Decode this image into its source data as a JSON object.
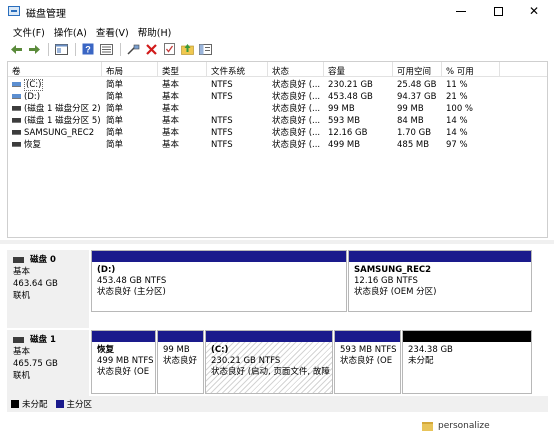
{
  "window": {
    "title": "磁盘管理",
    "minimize": "–",
    "maximize": "□",
    "close": "✕"
  },
  "menu": [
    "文件(F)",
    "操作(A)",
    "查看(V)",
    "帮助(H)"
  ],
  "toolbar": {
    "icons": [
      "back-arrow-icon",
      "forward-arrow-icon",
      "console-icon",
      "help-icon",
      "list-view-icon",
      "connect-icon",
      "delete-icon",
      "properties-icon",
      "folder-up-icon",
      "info-icon",
      "refresh-icon"
    ]
  },
  "volume_list": {
    "headers": [
      "卷",
      "布局",
      "类型",
      "文件系统",
      "状态",
      "容量",
      "可用空间",
      "% 可用"
    ],
    "rows": [
      {
        "name": "(C:)",
        "layout": "简单",
        "type": "基本",
        "fs": "NTFS",
        "status": "状态良好 (...",
        "capacity": "230.21 GB",
        "free": "25.48 GB",
        "pct": "11 %",
        "icon": "blue",
        "selected": true
      },
      {
        "name": "(D:)",
        "layout": "简单",
        "type": "基本",
        "fs": "NTFS",
        "status": "状态良好 (...",
        "capacity": "453.48 GB",
        "free": "94.37 GB",
        "pct": "21 %",
        "icon": "blue",
        "selected": false
      },
      {
        "name": "(磁盘 1 磁盘分区 2)",
        "layout": "简单",
        "type": "基本",
        "fs": "",
        "status": "状态良好 (...",
        "capacity": "99 MB",
        "free": "99 MB",
        "pct": "100 %",
        "icon": "dark",
        "selected": false
      },
      {
        "name": "(磁盘 1 磁盘分区 5)",
        "layout": "简单",
        "type": "基本",
        "fs": "NTFS",
        "status": "状态良好 (...",
        "capacity": "593 MB",
        "free": "84 MB",
        "pct": "14 %",
        "icon": "dark",
        "selected": false
      },
      {
        "name": "SAMSUNG_REC2",
        "layout": "简单",
        "type": "基本",
        "fs": "NTFS",
        "status": "状态良好 (...",
        "capacity": "12.16 GB",
        "free": "1.70 GB",
        "pct": "14 %",
        "icon": "dark",
        "selected": false
      },
      {
        "name": "恢复",
        "layout": "简单",
        "type": "基本",
        "fs": "NTFS",
        "status": "状态良好 (...",
        "capacity": "499 MB",
        "free": "485 MB",
        "pct": "97 %",
        "icon": "dark",
        "selected": false
      }
    ]
  },
  "disks": [
    {
      "name": "磁盘 0",
      "type": "基本",
      "size": "463.64 GB",
      "status": "联机",
      "partitions": [
        {
          "name": "(D:)",
          "size": "453.48 GB NTFS",
          "status": "状态良好 (主分区)"
        },
        {
          "name": "SAMSUNG_REC2",
          "size": "12.16 GB NTFS",
          "status": "状态良好 (OEM 分区)"
        }
      ]
    },
    {
      "name": "磁盘 1",
      "type": "基本",
      "size": "465.75 GB",
      "status": "联机",
      "partitions": [
        {
          "name": "恢复",
          "size": "499 MB NTFS",
          "status": "状态良好 (OE"
        },
        {
          "name": "",
          "size": "99 MB",
          "status": "状态良好"
        },
        {
          "name": "(C:)",
          "size": "230.21 GB NTFS",
          "status": "状态良好 (启动, 页面文件, 故障"
        },
        {
          "name": "",
          "size": "593 MB NTFS",
          "status": "状态良好 (OE"
        },
        {
          "name": "",
          "size": "234.38 GB",
          "status": "未分配"
        }
      ]
    }
  ],
  "legend": [
    "未分配",
    "主分区"
  ],
  "colors": {
    "primary_partition": "#1a1a8c",
    "unallocated": "#000000"
  },
  "background_text": "personalize"
}
